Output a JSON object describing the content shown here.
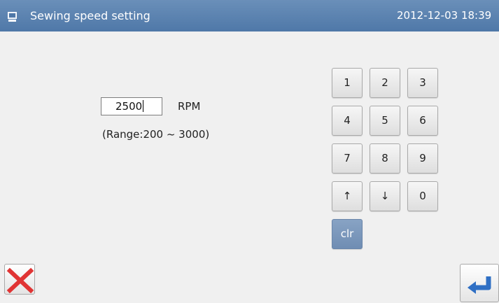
{
  "header": {
    "title": "Sewing speed setting",
    "datetime": "2012-12-03  18:39",
    "icon": "monitor-icon"
  },
  "speed": {
    "value": "2500",
    "unit": "RPM",
    "range_text": "(Range:200 ~ 3000)"
  },
  "keypad": {
    "k1": "1",
    "k2": "2",
    "k3": "3",
    "k4": "4",
    "k5": "5",
    "k6": "6",
    "k7": "7",
    "k8": "8",
    "k9": "9",
    "up": "↑",
    "down": "↓",
    "k0": "0",
    "clr": "clr"
  },
  "footer": {
    "cancel_icon": "x-icon",
    "confirm_icon": "enter-icon"
  },
  "colors": {
    "titlebar": "#5b82b0",
    "clr_key": "#7b98bc",
    "cancel": "#e03434",
    "enter": "#2f6fc4"
  }
}
